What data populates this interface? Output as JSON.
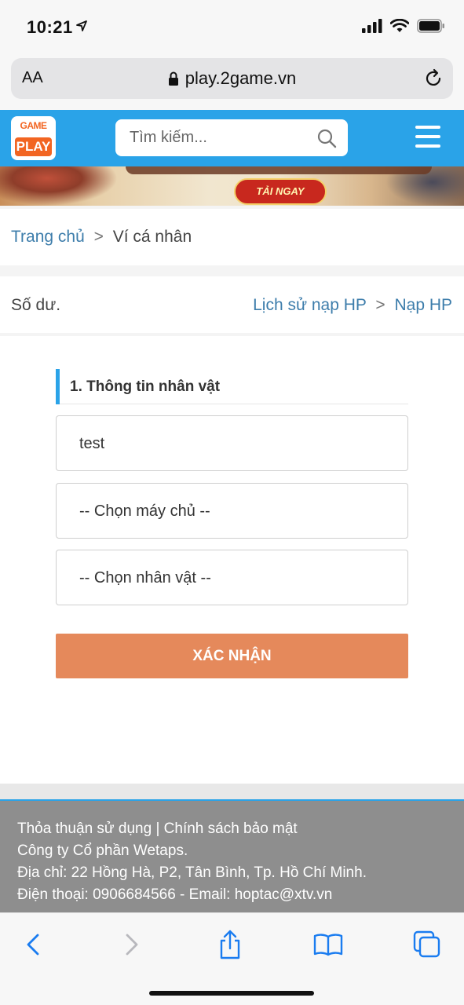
{
  "status_bar": {
    "time": "10:21"
  },
  "browser": {
    "text_size_label": "AA",
    "url": "play.2game.vn"
  },
  "header": {
    "logo_top": "GAME",
    "logo_bottom": "PLAY",
    "search_placeholder": "Tìm kiếm..."
  },
  "banner": {
    "download_label": "TẢI NGAY"
  },
  "breadcrumb": {
    "home": "Trang chủ",
    "separator": ">",
    "current": "Ví cá nhân"
  },
  "balance": {
    "label": "Số dư.",
    "history_link": "Lịch sử nạp HP",
    "separator": ">",
    "topup_link": "Nạp HP"
  },
  "form": {
    "section_title": "1. Thông tin nhân vật",
    "account_value": "test",
    "server_select": "-- Chọn máy chủ --",
    "character_select": "-- Chọn nhân vật --",
    "confirm_label": "XÁC NHẬN"
  },
  "footer": {
    "line1": "Thỏa thuận sử dụng | Chính sách bảo mật",
    "line2": "Công ty Cổ phần Wetaps.",
    "line3": "Địa chỉ: 22 Hồng Hà, P2, Tân Bình, Tp. Hồ Chí Minh.",
    "line4": "Điện thoại: 0906684566 - Email: hoptac@xtv.vn"
  },
  "colors": {
    "header_blue": "#2aa3e8",
    "link_blue": "#3d7dab",
    "confirm_orange": "#e5895b",
    "footer_gray": "#8e8e8e",
    "safari_blue": "#1a7cf0"
  },
  "icons": [
    "location-arrow-icon",
    "signal-icon",
    "wifi-icon",
    "battery-icon",
    "lock-icon",
    "reload-icon",
    "search-icon",
    "hamburger-menu-icon",
    "back-arrow-icon",
    "forward-arrow-icon",
    "share-icon",
    "bookmarks-icon",
    "tabs-icon"
  ]
}
